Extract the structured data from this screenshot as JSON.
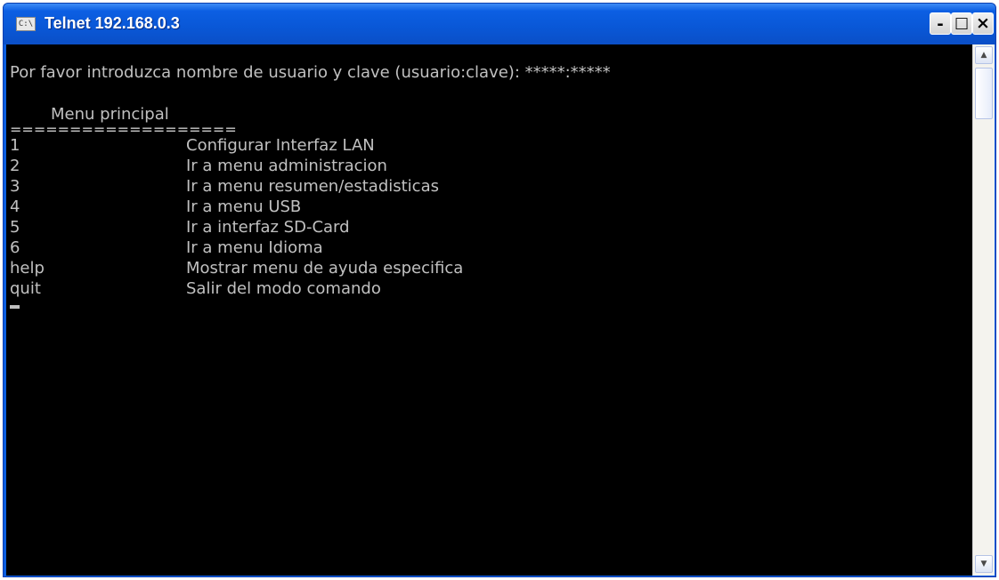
{
  "window": {
    "title": "Telnet 192.168.0.3",
    "icon_label": "C:\\",
    "controls": {
      "minimize": "-",
      "maximize": "□",
      "close": "×"
    }
  },
  "console": {
    "prompt": "Por favor introduzca nombre de usuario y clave (usuario:clave): *****:*****",
    "menu_title": "Menu principal",
    "separator": "===================",
    "items": [
      {
        "key": "1",
        "description": "Configurar Interfaz LAN"
      },
      {
        "key": "2",
        "description": "Ir a menu administracion"
      },
      {
        "key": "3",
        "description": "Ir a menu resumen/estadisticas"
      },
      {
        "key": "4",
        "description": "Ir a menu USB"
      },
      {
        "key": "5",
        "description": "Ir a interfaz SD-Card"
      },
      {
        "key": "6",
        "description": "Ir a menu Idioma"
      },
      {
        "key": "help",
        "description": "Mostrar menu de ayuda especifica"
      },
      {
        "key": "quit",
        "description": "Salir del modo comando"
      }
    ],
    "colors": {
      "background": "#000000",
      "text": "#c0c0c0",
      "titlebar": "#0b5ee0"
    }
  },
  "scrollbar": {
    "up_arrow": "▲",
    "down_arrow": "▼"
  }
}
